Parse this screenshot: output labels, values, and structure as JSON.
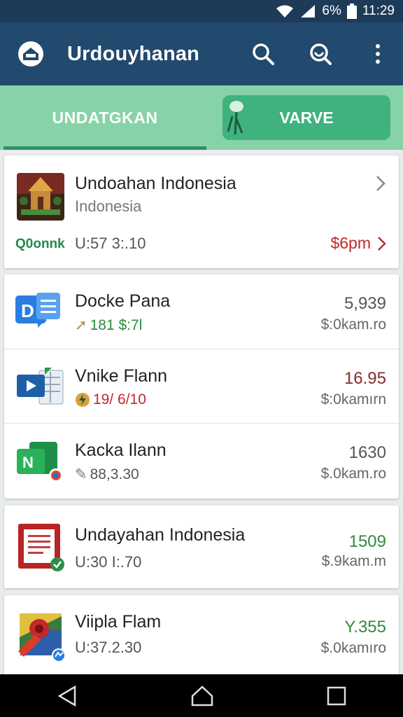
{
  "status": {
    "battery": "6%",
    "time": "11:29"
  },
  "appbar": {
    "title": "Urdouyhanan",
    "icons": [
      "home-icon",
      "search-icon",
      "scan-search-icon",
      "more-vert-icon"
    ]
  },
  "tabs": [
    {
      "label": "UNDATGKAN",
      "selected": true
    },
    {
      "label": "VARVE",
      "selected": false
    }
  ],
  "featured": {
    "name": "Undoahan Indonesia",
    "subtitle": "Indonesia",
    "tag": "Q0onnk",
    "meta": "U:57 3:.10",
    "price": "$6pm"
  },
  "list": [
    {
      "name": "Docke Pana",
      "meta": "181 $:7l",
      "price": "5,939",
      "unit": "$:0kam.ro",
      "icon": "docs-icon"
    },
    {
      "name": "Vnike Flann",
      "meta": "19/ 6/10",
      "price": "16.95",
      "unit": "$:0kamırn",
      "icon": "slides-sheet-icon"
    },
    {
      "name": "Kacka Ilann",
      "meta": "88,3.30",
      "price": "1630",
      "unit": "$.0kam.ro",
      "icon": "notes-icon"
    }
  ],
  "card_two": {
    "name": "Undayahan Indonesia",
    "meta": "U:30 I:.70",
    "price": "1509",
    "unit": "$.9kam.m",
    "icon": "document-icon"
  },
  "card_three": {
    "name": "Viipla Flam",
    "meta": "U:37.2.30",
    "price": "Y.355",
    "unit": "$.0kamıro",
    "icon": "maps-icon"
  },
  "colors": {
    "appbar": "#22496e",
    "statusbar": "#1d3b58",
    "tabbar": "#86d3a7",
    "active_tab": "#3fb27e",
    "positive": "#2e8b3e",
    "negative": "#c0282d"
  }
}
